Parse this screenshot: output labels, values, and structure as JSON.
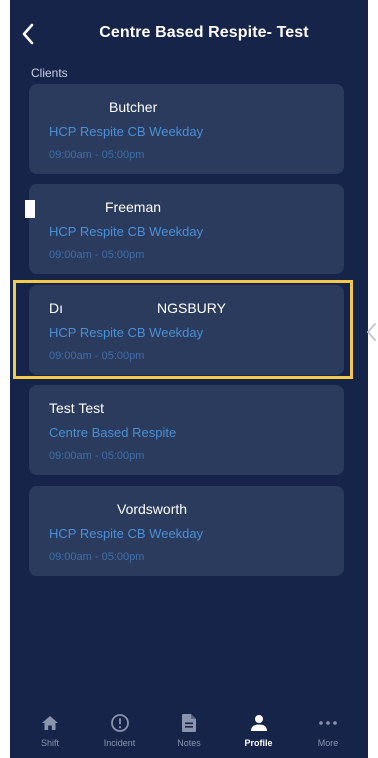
{
  "header": {
    "title": "Centre Based Respite- Test",
    "back_icon": "chevron-left-icon"
  },
  "section": {
    "label": "Clients"
  },
  "clients": [
    {
      "name": "Butcher",
      "program": "HCP Respite CB Weekday",
      "time": "09:00am - 05:00pm"
    },
    {
      "name": "Freeman",
      "program": "HCP Respite CB Weekday",
      "time": "09:00am - 05:00pm"
    },
    {
      "name": "NGSBURY",
      "name_prefix": "Dı",
      "program": "HCP Respite CB Weekday",
      "time": "09:00am - 05:00pm"
    },
    {
      "name": "Test Test",
      "program": "Centre Based Respite",
      "time": "09:00am - 05:00pm"
    },
    {
      "name": "Vordsworth",
      "program": "HCP Respite CB Weekday",
      "time": "09:00am - 05:00pm"
    }
  ],
  "tabs": [
    {
      "label": "Shift",
      "icon": "home-icon",
      "active": false
    },
    {
      "label": "Incident",
      "icon": "alert-circle-icon",
      "active": false
    },
    {
      "label": "Notes",
      "icon": "notes-icon",
      "active": false
    },
    {
      "label": "Profile",
      "icon": "profile-icon",
      "active": true
    },
    {
      "label": "More",
      "icon": "more-icon",
      "active": false
    }
  ],
  "colors": {
    "background": "#162449",
    "card": "#2a3b5e",
    "program_text": "#4a90d6",
    "time_text": "#3f6fa8",
    "highlight": "#f3c84b"
  }
}
